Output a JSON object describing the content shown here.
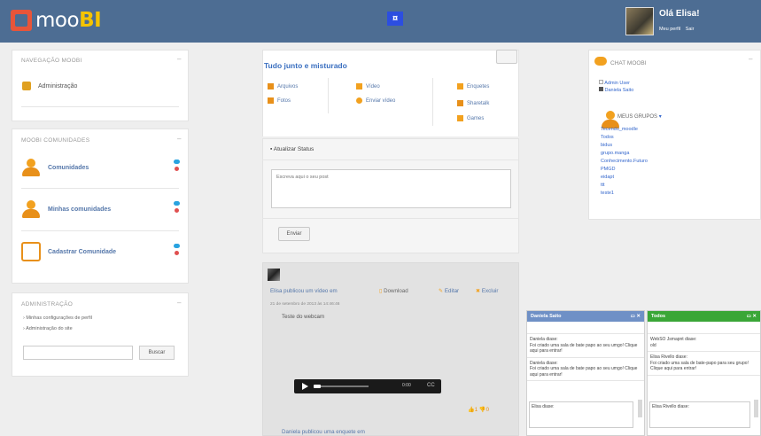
{
  "header": {
    "logo_text": "moo",
    "logo_accent": "BI",
    "greeting": "Olá Elisa!",
    "profile_link": "Meu perfil",
    "logout_link": "Sair",
    "center_icon_label": "¤"
  },
  "nav": {
    "title": "Navegação moobi",
    "toggle": "–",
    "items": [
      {
        "label": "Administração"
      }
    ]
  },
  "communities": {
    "title": "moobi comunidades",
    "toggle": "–",
    "items": [
      {
        "label": "Comunidades"
      },
      {
        "label": "Minhas comunidades"
      },
      {
        "label": "Cadastrar Comunidade"
      }
    ]
  },
  "admin": {
    "title": "Administração",
    "toggle": "–",
    "items": [
      {
        "label": "Minhas configurações de perfil"
      },
      {
        "label": "Administração do site"
      }
    ],
    "search_placeholder": "",
    "search_button": "Buscar"
  },
  "feed": {
    "title": "Tudo junto e misturado",
    "categories": [
      {
        "label": "Arquivos"
      },
      {
        "label": "Fotos"
      },
      {
        "label": "Vídeo"
      },
      {
        "label": "Enviar vídeo"
      },
      {
        "label": "Enquetes"
      },
      {
        "label": "Sharetalk"
      },
      {
        "label": "Games"
      }
    ],
    "status_label": "Atualizar Status",
    "status_placeholder": "Escreva aqui o seu post",
    "send_button": "Enviar"
  },
  "post": {
    "headline": "Elisa publicou um vídeo em",
    "download": "Download",
    "edit": "Editar",
    "delete": "Excluir",
    "meta": "21 de setembro de 2013 às 14:46:46",
    "body": "Teste do webcam",
    "video_time": "0:00",
    "video_cc": "CC",
    "likes": "1",
    "dislikes": "0",
    "next_post": "Daniela publicou uma enquete em"
  },
  "chat": {
    "title": "Chat moobi",
    "toggle": "–",
    "users": [
      {
        "name": "Admin User"
      },
      {
        "name": "Daniela Saito"
      }
    ],
    "groups_title": "Meus grupos",
    "groups": [
      {
        "name": "Tecendo_moodle"
      },
      {
        "name": "Todos"
      },
      {
        "name": "bidus"
      },
      {
        "name": "grupo.manga"
      },
      {
        "name": "Conhecimento.Futuro"
      },
      {
        "name": "PMGD"
      },
      {
        "name": "eidapt"
      },
      {
        "name": "ttt"
      },
      {
        "name": "teste1"
      }
    ]
  },
  "chat_windows": [
    {
      "title": "Daniela Saito",
      "header_color": "#6f90c6",
      "messages": [
        {
          "author": "Daniela diase:",
          "text": "Foi criado uma sala de bate papo ao seu umgo! Clique aqui para entrar!"
        },
        {
          "author": "Daniela diase:",
          "text": "Foi criado uma sala de bate papo ao seu umgo! Clique aqui para entrar!"
        }
      ],
      "input_text": "Elisa diase:"
    },
    {
      "title": "Todos",
      "header_color": "#3aa637",
      "messages": [
        {
          "author": "WebSO Jsmapnt diase:",
          "text": "old"
        },
        {
          "author": "Elisa Rivello diase:",
          "text": "Foi criado uma sala de bate-papo para seu grupo! Clique aqui para entrar!"
        }
      ],
      "input_text": "Elisa Rivello diase:"
    }
  ]
}
